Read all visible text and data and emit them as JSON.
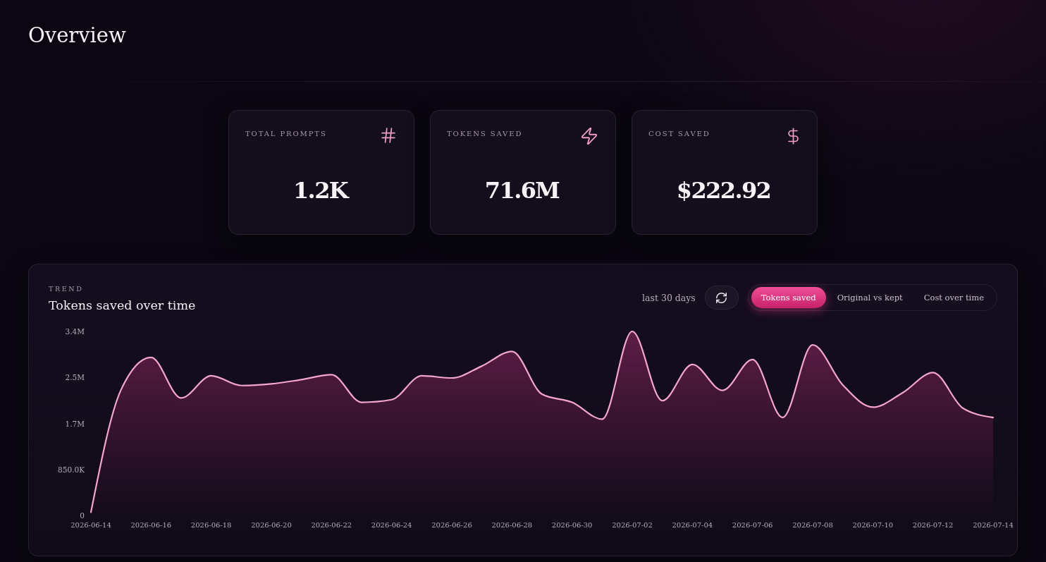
{
  "page": {
    "title": "Overview"
  },
  "stats": [
    {
      "label": "TOTAL PROMPTS",
      "value": "1.2K"
    },
    {
      "label": "TOKENS SAVED",
      "value": "71.6M"
    },
    {
      "label": "COST SAVED",
      "value": "$222.92"
    }
  ],
  "trend": {
    "eyebrow": "TREND",
    "title": "Tokens saved over time",
    "range": "last 30 days",
    "tabs": [
      {
        "label": "Tokens saved",
        "selected": true
      },
      {
        "label": "Original vs kept",
        "selected": false
      },
      {
        "label": "Cost over time",
        "selected": false
      }
    ],
    "chart_data": {
      "type": "area",
      "categories": [
        "2026-06-14",
        null,
        "2026-06-16",
        null,
        "2026-06-18",
        null,
        "2026-06-20",
        null,
        "2026-06-22",
        null,
        "2026-06-24",
        null,
        "2026-06-26",
        null,
        "2026-06-28",
        null,
        "2026-06-30",
        null,
        "2026-07-02",
        null,
        "2026-07-04",
        null,
        "2026-07-06",
        null,
        "2026-07-08",
        null,
        "2026-07-10",
        null,
        "2026-07-12",
        null,
        "2026-07-14"
      ],
      "series": [
        {
          "color": "#f4a6cf",
          "values": [
            60000,
            2320000,
            2920000,
            2170000,
            2580000,
            2400000,
            2430000,
            2510000,
            2600000,
            2090000,
            2140000,
            2580000,
            2540000,
            2760000,
            3030000,
            2240000,
            2090000,
            1780000,
            3400000,
            2120000,
            2790000,
            2310000,
            2880000,
            1810000,
            3150000,
            2410000,
            2000000,
            2270000,
            2640000,
            1980000,
            1810000
          ]
        }
      ],
      "ylim": [
        0,
        3400000
      ],
      "yticks": [
        {
          "value": 0,
          "label": "0"
        },
        {
          "value": 850000,
          "label": "850.0K"
        },
        {
          "value": 1700000,
          "label": "1.7M"
        },
        {
          "value": 2550000,
          "label": "2.5M"
        },
        {
          "value": 3400000,
          "label": "3.4M"
        }
      ]
    }
  }
}
